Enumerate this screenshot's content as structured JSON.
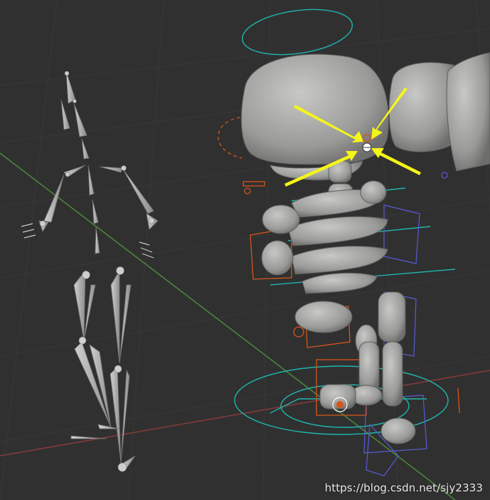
{
  "watermark": {
    "text": "https://blog.csdn.net/sjy2333"
  },
  "colors": {
    "background": "#303030",
    "grid_line": "#3a3a3a",
    "x_axis": "#8a3a3a",
    "y_axis": "#4c8a3a",
    "bone": "#b5b5b5",
    "mesh": "#a9a9a7",
    "control_teal": "#1fb5ad",
    "control_orange": "#d5561c",
    "control_blue": "#5a5ad8",
    "annotation_arrow": "#f5f51a"
  },
  "icons": [
    "armature-bones",
    "character-mesh",
    "selected-bone-gizmo",
    "annotation-arrow"
  ]
}
